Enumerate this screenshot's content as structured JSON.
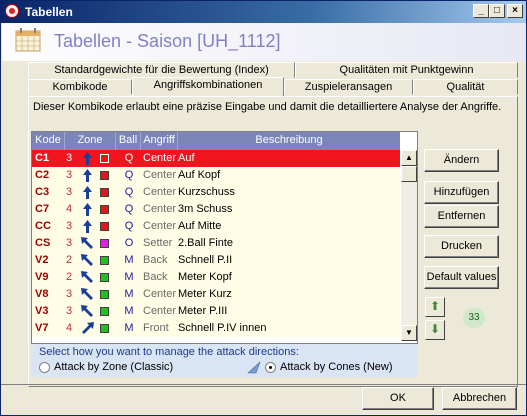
{
  "window": {
    "title": "Tabellen"
  },
  "header": {
    "title": "Tabellen - Saison [UH_1112]"
  },
  "tabs": {
    "row1": [
      "Standardgewichte für die Bewertung (Index)",
      "Qualitäten mit Punktgewinn"
    ],
    "row2": [
      "Kombikode",
      "Angriffskombinationen",
      "Zuspieleransagen",
      "Qualität"
    ],
    "active": "Angriffskombinationen"
  },
  "description": "Dieser Kombikode erlaubt eine präzise Eingabe und damit die detailliertere Analyse der Angriffe.",
  "grid": {
    "columns": [
      "Kode",
      "Zone",
      "Ball",
      "Angriff",
      "Beschreibung"
    ],
    "rows": [
      {
        "kode": "C1",
        "zone": "3",
        "dir": "up",
        "color": "#e01818",
        "ball": "Q",
        "angriff": "Center",
        "beschreibung": "Auf",
        "selected": true
      },
      {
        "kode": "C2",
        "zone": "3",
        "dir": "up",
        "color": "#e01818",
        "ball": "Q",
        "angriff": "Center",
        "beschreibung": "Auf Kopf",
        "selected": false
      },
      {
        "kode": "C3",
        "zone": "3",
        "dir": "up",
        "color": "#e01818",
        "ball": "Q",
        "angriff": "Center",
        "beschreibung": "Kurzschuss",
        "selected": false
      },
      {
        "kode": "C7",
        "zone": "4",
        "dir": "up",
        "color": "#e01818",
        "ball": "Q",
        "angriff": "Center",
        "beschreibung": "3m Schuss",
        "selected": false
      },
      {
        "kode": "CC",
        "zone": "3",
        "dir": "up",
        "color": "#e01818",
        "ball": "Q",
        "angriff": "Center",
        "beschreibung": "Auf Mitte",
        "selected": false
      },
      {
        "kode": "CS",
        "zone": "3",
        "dir": "upleft",
        "color": "#e020e0",
        "ball": "O",
        "angriff": "Setter",
        "beschreibung": "2.Ball Finte",
        "selected": false
      },
      {
        "kode": "V2",
        "zone": "2",
        "dir": "upleft",
        "color": "#20c020",
        "ball": "M",
        "angriff": "Back",
        "beschreibung": "Schnell P.II",
        "selected": false
      },
      {
        "kode": "V9",
        "zone": "2",
        "dir": "upleft",
        "color": "#20c020",
        "ball": "M",
        "angriff": "Back",
        "beschreibung": "Meter Kopf",
        "selected": false
      },
      {
        "kode": "V8",
        "zone": "3",
        "dir": "upleft",
        "color": "#20c020",
        "ball": "M",
        "angriff": "Center",
        "beschreibung": "Meter Kurz",
        "selected": false
      },
      {
        "kode": "V3",
        "zone": "3",
        "dir": "upleft",
        "color": "#20c020",
        "ball": "M",
        "angriff": "Center",
        "beschreibung": "Meter P.III",
        "selected": false
      },
      {
        "kode": "V7",
        "zone": "4",
        "dir": "upright",
        "color": "#20c020",
        "ball": "M",
        "angriff": "Front",
        "beschreibung": "Schnell P.IV innen",
        "selected": false
      }
    ]
  },
  "buttons": {
    "aendern": "Ändern",
    "hinzufuegen": "Hinzufügen",
    "entfernen": "Entfernen",
    "drucken": "Drucken",
    "default_values": "Default values",
    "ok": "OK",
    "abbrechen": "Abbrechen"
  },
  "count_badge": "33",
  "attack_directions": {
    "question": "Select how you want to manage the attack directions:",
    "option_zone": "Attack by Zone (Classic)",
    "option_cones": "Attack by Cones (New)",
    "selected": "cones"
  },
  "colors": {
    "accent": "#7a86b8",
    "selected_row": "#f0141e",
    "row_bg": "#fffde6",
    "code_text": "#9c0000",
    "title": "#8080c8"
  }
}
